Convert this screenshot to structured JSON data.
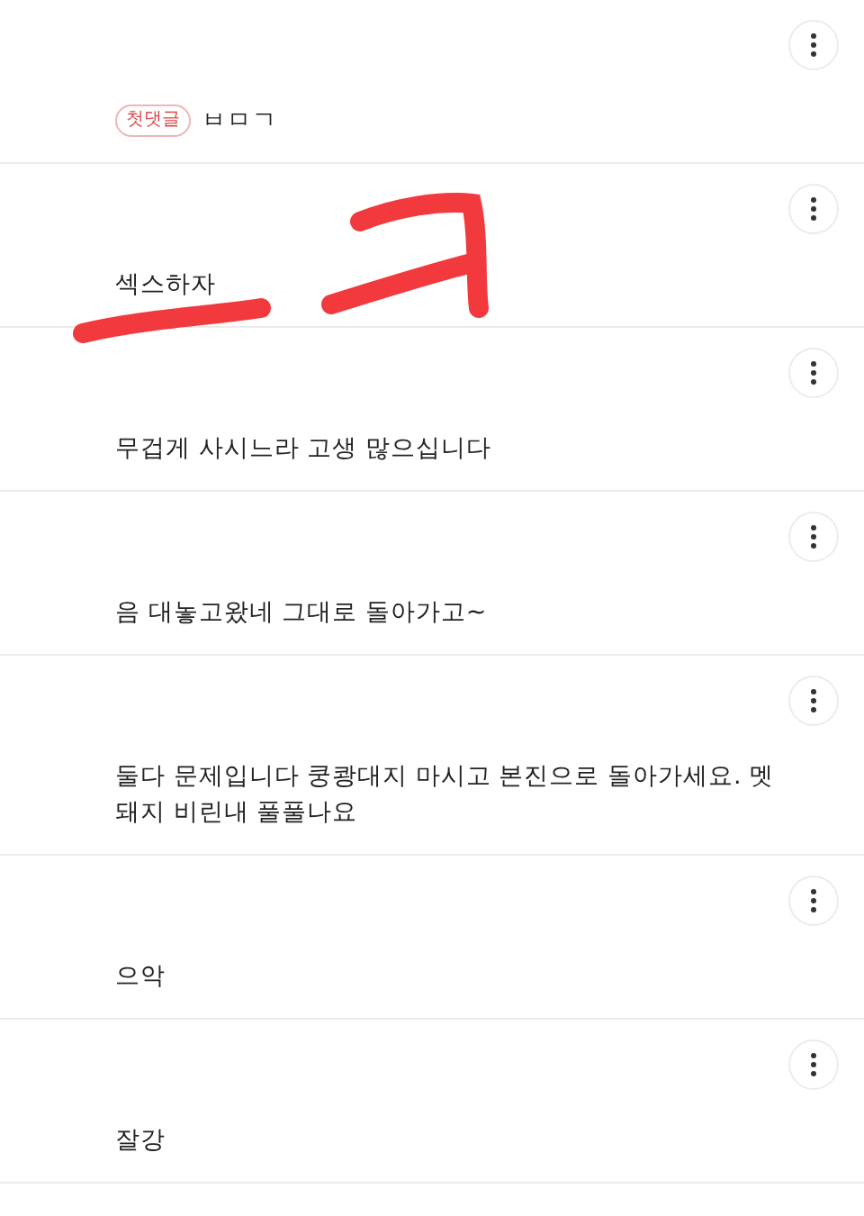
{
  "comments": [
    {
      "badge": "첫댓글",
      "text": "ㅂㅁㄱ"
    },
    {
      "text": "섹스하자",
      "annotation": {
        "kind": "scribble"
      }
    },
    {
      "text": "무겁게 사시느라 고생 많으십니다"
    },
    {
      "text": "음 대놓고왔네 그대로 돌아가고~"
    },
    {
      "text": "둘다 문제입니다 쿵쾅대지 마시고 본진으로 돌아가세요. 멧돼지 비린내 풀풀나요"
    },
    {
      "text": "으악"
    },
    {
      "text": "잘강"
    }
  ]
}
